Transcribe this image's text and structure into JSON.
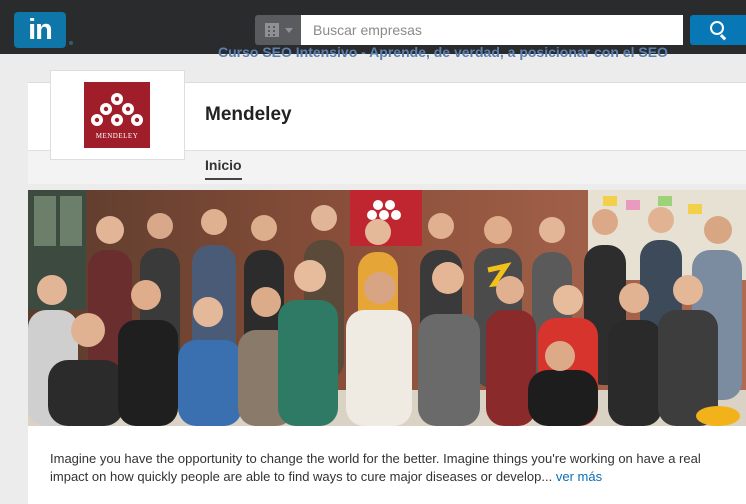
{
  "header": {
    "search_placeholder": "Buscar empresas",
    "logo_text": "in"
  },
  "ad_banner": {
    "text": "Curso SEO Intensivo - Aprende, de verdad, a posicionar con el SEO"
  },
  "company": {
    "name": "Mendeley",
    "logo_text": "MENDELEY",
    "tabs": [
      {
        "label": "Inicio",
        "active": true
      }
    ]
  },
  "description": {
    "text": "Imagine you have the opportunity to change the world for the better. Imagine things you're working on have a real impact on how quickly people are able to find ways to cure major diseases or develop...",
    "more_link": "ver más"
  },
  "colors": {
    "linkedin_blue": "#0e76a8",
    "mendeley_red": "#a01e2a",
    "topbar": "#2a2b2d",
    "link": "#0a6fb5"
  }
}
